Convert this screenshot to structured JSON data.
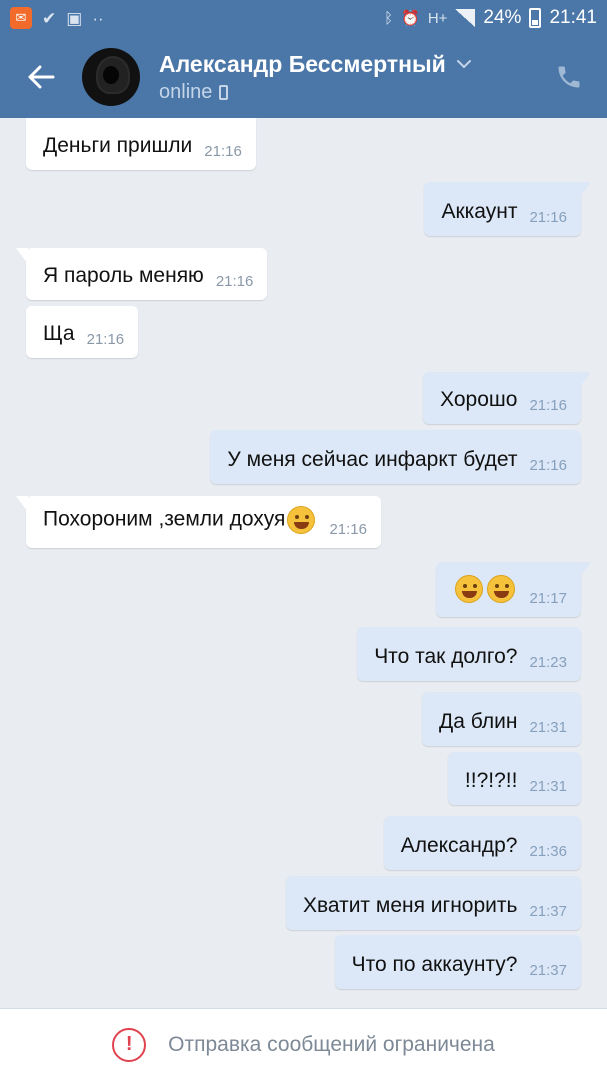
{
  "status_bar": {
    "network": "H+",
    "battery": "24%",
    "time": "21:41"
  },
  "header": {
    "contact_name": "Александр Бессмертный",
    "status": "online",
    "icons": [
      "back-arrow-icon",
      "chevron-down-icon",
      "mobile-icon",
      "phone-call-icon"
    ]
  },
  "messages": [
    {
      "dir": "in",
      "text": "Деньги пришли",
      "time": "21:16"
    },
    {
      "dir": "out",
      "text": "Аккаунт",
      "time": "21:16"
    },
    {
      "dir": "in",
      "text": "Я пароль меняю",
      "time": "21:16"
    },
    {
      "dir": "in",
      "text": "Ща",
      "time": "21:16"
    },
    {
      "dir": "out",
      "text": "Хорошо",
      "time": "21:16"
    },
    {
      "dir": "out",
      "text": "У  меня сейчас инфаркт будет",
      "time": "21:16"
    },
    {
      "dir": "in",
      "text": "Похороним ,земли дохуя",
      "time": "21:16"
    },
    {
      "dir": "out",
      "text": "",
      "time": "21:17"
    },
    {
      "dir": "out",
      "text": "Что так долго?",
      "time": "21:23"
    },
    {
      "dir": "out",
      "text": "Да блин",
      "time": "21:31"
    },
    {
      "dir": "out",
      "text": "!!?!?!!",
      "time": "21:31"
    },
    {
      "dir": "out",
      "text": "Александр?",
      "time": "21:36"
    },
    {
      "dir": "out",
      "text": "Хватит меня игнорить",
      "time": "21:37"
    },
    {
      "dir": "out",
      "text": "Что по аккаунту?",
      "time": "21:37"
    }
  ],
  "footer": {
    "restricted_text": "Отправка сообщений ограничена"
  },
  "colors": {
    "header_bg": "#4a76a8",
    "chat_bg": "#e9edf2",
    "out_bubble": "#dce8f7",
    "in_bubble": "#ffffff",
    "warning": "#e0434e"
  }
}
